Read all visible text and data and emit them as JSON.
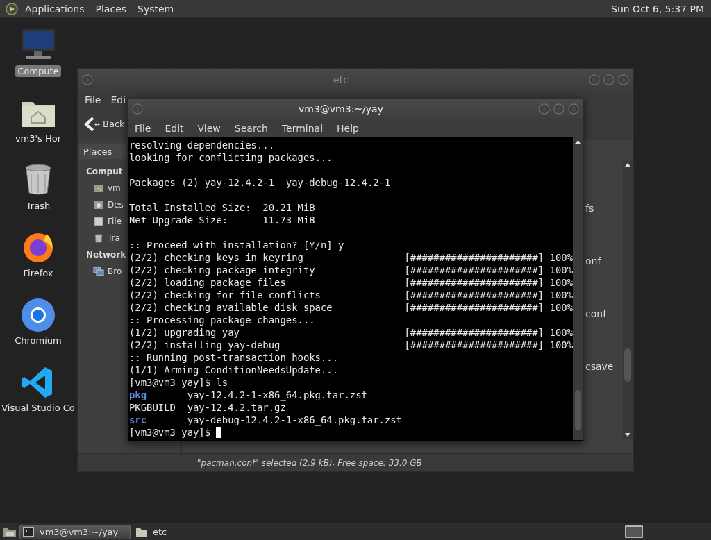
{
  "top_panel": {
    "menus": [
      "Applications",
      "Places",
      "System"
    ],
    "clock": "Sun Oct 6, 5:37 PM"
  },
  "desktop_icons": [
    {
      "kind": "computer",
      "label": "Compute",
      "selected": true
    },
    {
      "kind": "home",
      "label": "vm3's Hor",
      "selected": false
    },
    {
      "kind": "trash",
      "label": "Trash",
      "selected": false
    },
    {
      "kind": "firefox",
      "label": "Firefox",
      "selected": false
    },
    {
      "kind": "chromium",
      "label": "Chromium",
      "selected": false
    },
    {
      "kind": "vscode",
      "label": "Visual Studio Co",
      "selected": false
    }
  ],
  "file_manager": {
    "title": "etc",
    "menus": [
      "File",
      "Edi"
    ],
    "back": "Back",
    "sidebar_header": "Places",
    "sidebar": [
      {
        "kind": "heading",
        "label": "Comput"
      },
      {
        "kind": "home",
        "label": "vm"
      },
      {
        "kind": "desktop",
        "label": "Des"
      },
      {
        "kind": "drive",
        "label": "File"
      },
      {
        "kind": "trash",
        "label": "Tra"
      },
      {
        "kind": "heading",
        "label": "Network"
      },
      {
        "kind": "network",
        "label": "Bro"
      }
    ],
    "files": [
      "fs",
      "onf",
      "conf",
      "csave"
    ],
    "status": "\"pacman.conf\" selected (2.9 kB), Free space: 33.0 GB"
  },
  "terminal": {
    "title": "vm3@vm3:~/yay",
    "menus": [
      "File",
      "Edit",
      "View",
      "Search",
      "Terminal",
      "Help"
    ],
    "lines": [
      {
        "kind": "text",
        "text": "resolving dependencies..."
      },
      {
        "kind": "text",
        "text": "looking for conflicting packages..."
      },
      {
        "kind": "blank"
      },
      {
        "kind": "text",
        "text": "Packages (2) yay-12.4.2-1  yay-debug-12.4.2-1"
      },
      {
        "kind": "blank"
      },
      {
        "kind": "text",
        "text": "Total Installed Size:  20.21 MiB"
      },
      {
        "kind": "text",
        "text": "Net Upgrade Size:      11.73 MiB"
      },
      {
        "kind": "blank"
      },
      {
        "kind": "text",
        "text": ":: Proceed with installation? [Y/n] y"
      },
      {
        "kind": "progress",
        "text": "(2/2) checking keys in keyring",
        "bar": "[######################]",
        "percent": "100%"
      },
      {
        "kind": "progress",
        "text": "(2/2) checking package integrity",
        "bar": "[######################]",
        "percent": "100%"
      },
      {
        "kind": "progress",
        "text": "(2/2) loading package files",
        "bar": "[######################]",
        "percent": "100%"
      },
      {
        "kind": "progress",
        "text": "(2/2) checking for file conflicts",
        "bar": "[######################]",
        "percent": "100%"
      },
      {
        "kind": "progress",
        "text": "(2/2) checking available disk space",
        "bar": "[######################]",
        "percent": "100%"
      },
      {
        "kind": "text",
        "text": ":: Processing package changes..."
      },
      {
        "kind": "progress",
        "text": "(1/2) upgrading yay",
        "bar": "[######################]",
        "percent": "100%"
      },
      {
        "kind": "progress",
        "text": "(2/2) installing yay-debug",
        "bar": "[######################]",
        "percent": "100%"
      },
      {
        "kind": "text",
        "text": ":: Running post-transaction hooks..."
      },
      {
        "kind": "text",
        "text": "(1/1) Arming ConditionNeedsUpdate..."
      },
      {
        "kind": "text",
        "text": "[vm3@vm3 yay]$ ls"
      },
      {
        "kind": "ls",
        "name": "pkg",
        "directory": true,
        "file": "yay-12.4.2-1-x86_64.pkg.tar.zst"
      },
      {
        "kind": "ls",
        "name": "PKGBUILD",
        "directory": false,
        "file": "yay-12.4.2.tar.gz"
      },
      {
        "kind": "ls",
        "name": "src",
        "directory": true,
        "file": "yay-debug-12.4.2-1-x86_64.pkg.tar.zst"
      },
      {
        "kind": "prompt",
        "text": "[vm3@vm3 yay]$"
      }
    ]
  },
  "taskbar": {
    "tasks": [
      {
        "kind": "terminal",
        "label": "vm3@vm3:~/yay",
        "selected": true
      },
      {
        "kind": "folder",
        "label": "etc",
        "selected": false
      }
    ]
  }
}
